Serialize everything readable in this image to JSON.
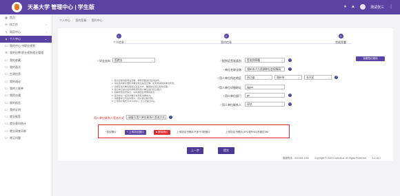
{
  "app": {
    "title": "天基大学 管理中心 | 学生版",
    "username": "测试张三"
  },
  "sidebar": {
    "items": [
      {
        "label": "首页",
        "icon": "home-icon",
        "glyph": "▦",
        "arrow": ""
      },
      {
        "label": "找工作",
        "icon": "briefcase-icon",
        "glyph": "✉",
        "arrow": "›"
      },
      {
        "label": "简历中心",
        "icon": "resume-icon",
        "glyph": "✎",
        "arrow": "›"
      },
      {
        "label": "个人中心",
        "icon": "user-icon",
        "glyph": "●",
        "arrow": "⌄",
        "active": true
      },
      {
        "label": "我的中心 中职业规划",
        "icon": "doc-icon",
        "glyph": "☐",
        "arrow": ""
      },
      {
        "label": "我的应聘 职业规划就业管理",
        "icon": "list-icon",
        "glyph": "☰",
        "arrow": ""
      },
      {
        "label": "我的收藏",
        "icon": "star-icon",
        "glyph": "☐",
        "arrow": ""
      },
      {
        "label": "我的面试",
        "icon": "calendar-icon",
        "glyph": "☐",
        "arrow": ""
      },
      {
        "label": "生源信息",
        "icon": "info-icon",
        "glyph": "☐",
        "arrow": ""
      },
      {
        "label": "我的调动",
        "icon": "transfer-icon",
        "glyph": "☐",
        "arrow": ""
      },
      {
        "label": "我的三联单",
        "icon": "form-icon",
        "glyph": "☐",
        "arrow": ""
      },
      {
        "label": "我的派遣",
        "icon": "send-icon",
        "glyph": "☐",
        "arrow": ""
      },
      {
        "label": "我的报告",
        "icon": "report-icon",
        "glyph": "☐",
        "arrow": ""
      },
      {
        "label": "我的证明",
        "icon": "cert-icon",
        "glyph": "☐",
        "arrow": ""
      },
      {
        "label": "就业推荐",
        "icon": "recommend-icon",
        "glyph": "☐",
        "arrow": ""
      },
      {
        "label": "就业意向统计",
        "icon": "chart-icon",
        "glyph": "☐",
        "arrow": ""
      },
      {
        "label": "就业调查问卷",
        "icon": "survey-icon",
        "glyph": "☐",
        "arrow": ""
      },
      {
        "label": "常见问题",
        "icon": "question-icon",
        "glyph": "☐",
        "arrow": ""
      }
    ]
  },
  "breadcrumb": {
    "items": [
      "个人中心",
      "签约签章",
      "签约中心"
    ]
  },
  "steps": [
    {
      "number": "1",
      "label": "个人信息",
      "color": "#5b43a3"
    },
    {
      "number": "2",
      "label": "签约信息",
      "color": "#5b43a3"
    },
    {
      "number": "3",
      "label": "完成签署",
      "color": "#5b43a3"
    }
  ],
  "view_agreement_button": "查看签约规则",
  "form": {
    "left": {
      "employment_type_label": "毕业去向",
      "employment_type_value": "签就业",
      "company_name_label": "用人单位联系人签名方式",
      "company_name_value": "请填写用人单位联系人签名方式"
    },
    "right": {
      "signing_method_label": "报到证签发类别",
      "signing_method_value": "签发到原籍",
      "unit_name_label": "单位名称全称",
      "unit_name_value": "湖州市人力资源和社会保障局",
      "unit_location_label": "用人单位所在地区",
      "unit_location_province": "浙江省",
      "unit_location_city": "湖州市",
      "unit_location_district": "长兴区",
      "unit_address_label": "用人单位详细地址",
      "unit_address_value": "fggsb",
      "unit_dept_label": "用人单位部门",
      "unit_dept_value": "gh",
      "unit_contact_label": "用人单位联系人",
      "unit_contact_value": "评估"
    }
  },
  "notes": [
    "1. 签约过程请登录后查看，按照流程进行签约操作；",
    "2. 请在签约前仔细核对单位信息是否正确，如有误请联系单位修改；",
    "3. 请填写用人单位联系人签名方式，确保信息真实有效完整；",
    "4. 签约信息提交后系统将通知用人单位进行线上确认；",
    "5. 如需修改签约信息，请先撤回后再重新提交；",
    "6. 签约协议一经双方确认将具有法律效力；",
    "7. 请按要求上传签约照片，照片需清晰可辨；",
    "8. 上传照片格式为JPG/PNG，大小不超过2M。"
  ],
  "upload": {
    "label": "协议照片",
    "upload_button": "上传协议照片",
    "delete_button": "删除照片",
    "hint_main": "上传协议书照片不多于3张照片",
    "hint_secondary": "上传协议书照片(JPG或PNG)不超过5M"
  },
  "actions": {
    "prev": "上一步",
    "submit": "提交"
  },
  "footer": {
    "hotline": "客服热线：400-061-1166",
    "copyright": "Copyright © 2021 GoWork.ai. All Rights Reserved.",
    "version": "1.2.16.2"
  },
  "colors": {
    "brand": "#5b43a3",
    "danger": "#e0262c"
  }
}
